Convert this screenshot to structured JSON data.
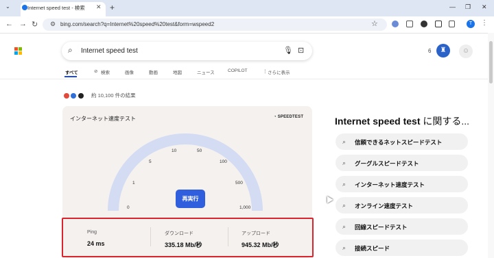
{
  "browser": {
    "tab_title": "Internet speed test - 検索",
    "url": "bing.com/search?q=Internet%20speed%20test&form=wspeed2",
    "profile_initial": "T"
  },
  "search": {
    "query": "Internet speed test",
    "rewards_count": "6"
  },
  "nav_tabs": [
    "すべて",
    "検索",
    "画像",
    "動画",
    "地図",
    "ニュース",
    "COPILOT",
    "さらに表示"
  ],
  "results": {
    "count_text": "約 10,100 件の結果"
  },
  "speedtest": {
    "title": "インターネット速度テスト",
    "brand": "SPEEDTEST",
    "gauge_ticks": [
      "0",
      "1",
      "5",
      "10",
      "50",
      "100",
      "500",
      "1,000"
    ],
    "rerun_label": "再実行",
    "stats": [
      {
        "label": "Ping",
        "value": "24 ms"
      },
      {
        "label": "ダウンロード",
        "value": "335.18 Mb/秒"
      },
      {
        "label": "アップロード",
        "value": "945.32 Mb/秒"
      }
    ]
  },
  "related": {
    "title_bold": "Internet speed test",
    "title_rest": " に関する...",
    "items": [
      "信頼できるネットスピードテスト",
      "グーグルスピードテスト",
      "インターネット速度テスト",
      "オンライン速度テスト",
      "回線スピードテスト",
      "接続スピード"
    ]
  },
  "colors": {
    "accent": "#2f5fdc",
    "highlight": "#d9232d",
    "gauge": "#d3dcf3"
  }
}
